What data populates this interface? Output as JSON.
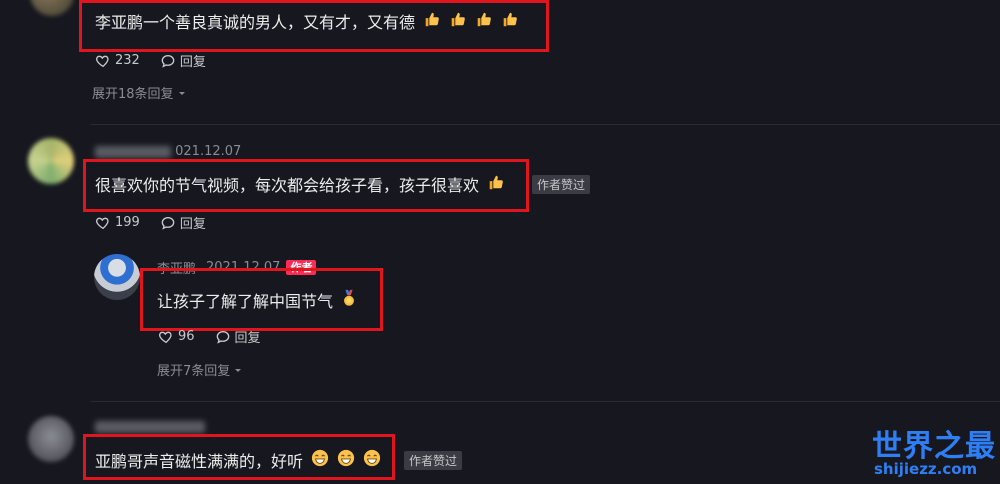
{
  "comments": [
    {
      "text": "李亚鹏一个善良真诚的男人，又有才，又有德",
      "emoji_count": 4,
      "likes": "232",
      "reply_label": "回复",
      "expand_label": "展开18条回复"
    },
    {
      "date": "021.12.07",
      "text": "很喜欢你的节气视频，每次都会给孩子看，孩子很喜欢",
      "emoji_count": 1,
      "author_liked_badge": "作者赞过",
      "likes": "199",
      "reply_label": "回复",
      "reply": {
        "username": "李亚鹏",
        "date": "2021.12.07",
        "author_badge": "作者",
        "text": "让孩子了解了解中国节气",
        "likes": "96",
        "reply_label": "回复"
      },
      "expand_label": "展开7条回复"
    },
    {
      "text": "亚鹏哥声音磁性满满的，好听",
      "emoji_count": 3,
      "author_liked_badge": "作者赞过"
    }
  ],
  "watermark": {
    "title": "世界之最",
    "url": "shijiezz.com"
  },
  "colors": {
    "background": "#17181f",
    "highlight_box": "#e0161e",
    "author_badge": "#fe2c55",
    "watermark": "#2e7ff6"
  },
  "icons": [
    "heart-outline-icon",
    "comment-bubble-icon",
    "thumbs-up-emoji",
    "medal-emoji",
    "grin-emoji",
    "chevron-down-icon"
  ]
}
